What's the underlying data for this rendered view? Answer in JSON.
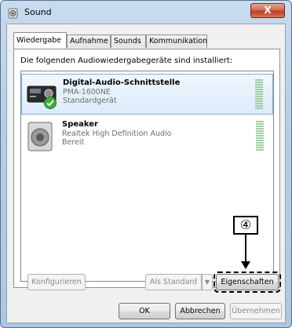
{
  "window": {
    "title": "Sound",
    "close_label": "X"
  },
  "tabs": [
    {
      "label": "Wiedergabe",
      "active": true
    },
    {
      "label": "Aufnahme",
      "active": false
    },
    {
      "label": "Sounds",
      "active": false
    },
    {
      "label": "Kommunikation",
      "active": false
    }
  ],
  "panel": {
    "heading": "Die folgenden Audiowiedergabegeräte sind installiert:"
  },
  "devices": [
    {
      "name": "Digital-Audio-Schnittstelle",
      "description": "PMA-1600NE",
      "status": "Standardgerät",
      "icon": "amplifier-icon",
      "default": true,
      "selected": true
    },
    {
      "name": "Speaker",
      "description": "Realtek High Definition Audio",
      "status": "Bereit",
      "icon": "speaker-icon",
      "default": false,
      "selected": false
    }
  ],
  "buttons": {
    "configure": "Konfigurieren",
    "set_default": "Als Standard",
    "properties": "Eigenschaften",
    "ok": "OK",
    "cancel": "Abbrechen",
    "apply": "Übernehmen"
  },
  "annotation": {
    "label": "④"
  },
  "colors": {
    "accent_selection": "#dcebfc",
    "default_check": "#3cad3c",
    "level_meter": "#9fcfa4"
  }
}
